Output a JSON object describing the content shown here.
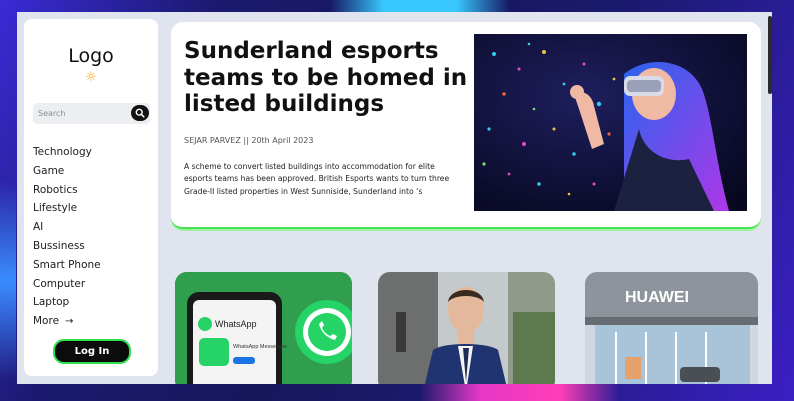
{
  "sidebar": {
    "logo": "Logo",
    "search_placeholder": "Search",
    "nav": [
      "Technology",
      "Game",
      "Robotics",
      "Lifestyle",
      "AI",
      "Bussiness",
      "Smart Phone",
      "Computer",
      "Laptop",
      "More"
    ],
    "login_label": "Log In"
  },
  "featured": {
    "title": "Sunderland esports teams to be homed in listed buildings",
    "meta": "SEJAR PARVEZ || 20th April 2023",
    "excerpt": "A scheme to convert listed buildings into accommodation for elite esports teams has been approved. British Esports wants to turn three Grade-II listed properties in West Sunniside, Sunderland into ’s"
  },
  "cards": [
    {
      "image_text": "WhatsApp",
      "subtext": "WhatsApp Messenger"
    },
    {
      "image_text": ""
    },
    {
      "image_text": "HUAWEI"
    }
  ],
  "colors": {
    "accent_green": "#2ee04a",
    "frame_blue": "#1c1a66",
    "whatsapp_green": "#2f9e4d"
  }
}
